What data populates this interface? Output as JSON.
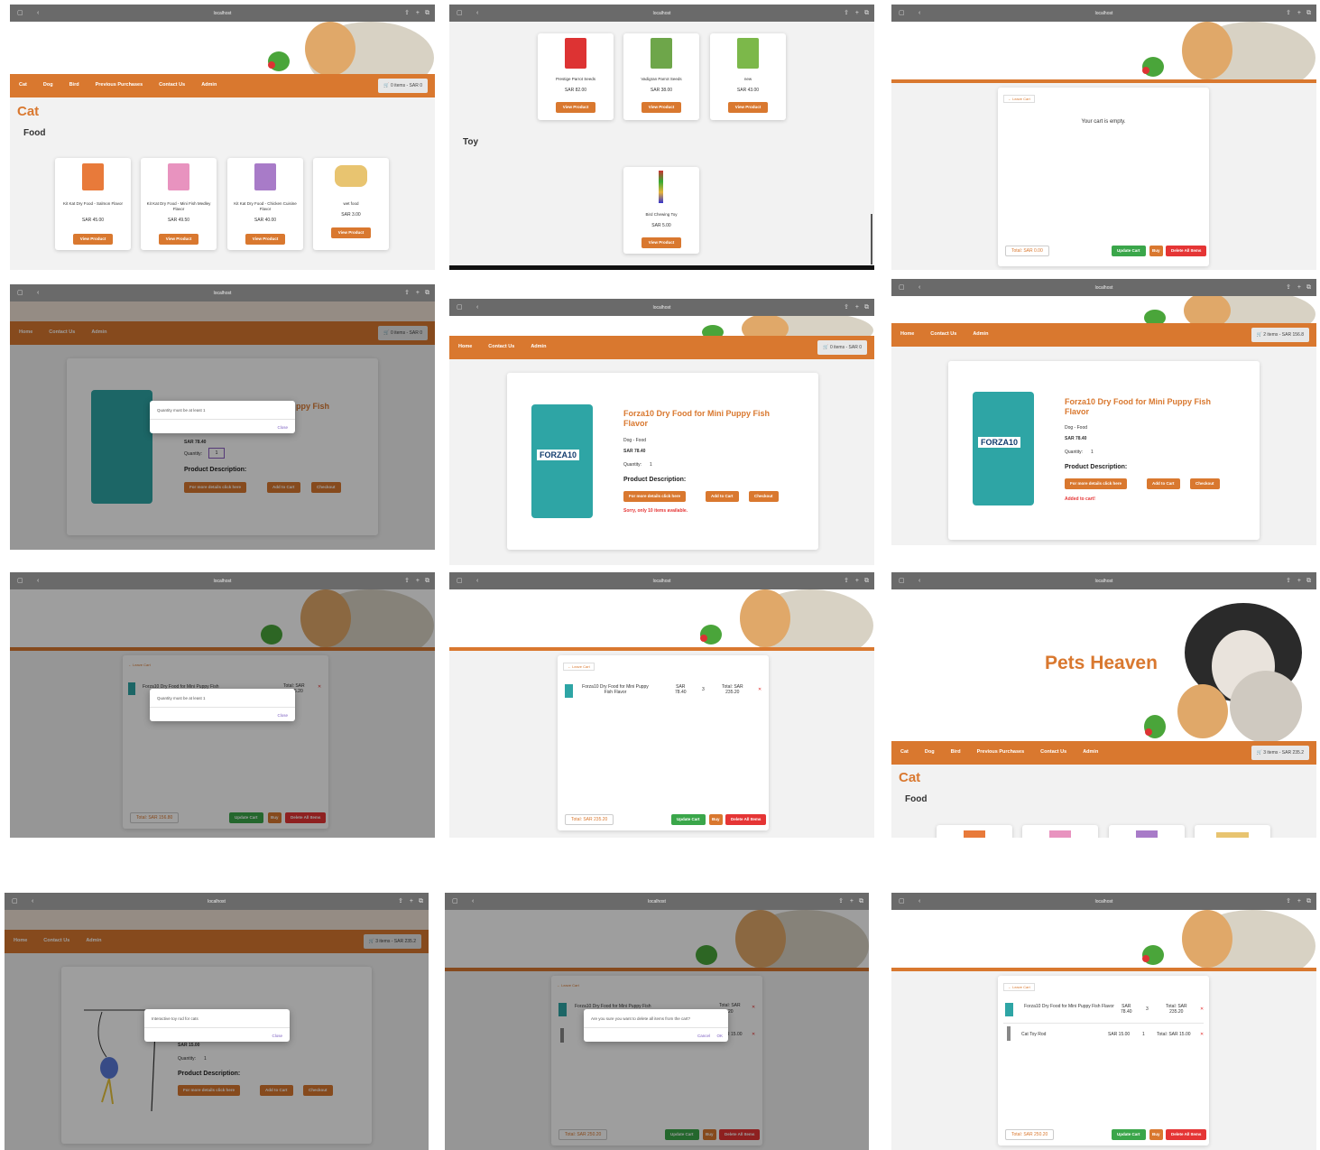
{
  "browser": {
    "url": "localhost"
  },
  "nav_main": [
    "Cat",
    "Dog",
    "Bird",
    "Previous Purchases",
    "Contact Us",
    "Admin"
  ],
  "nav_product": [
    "Home",
    "Contact Us",
    "Admin"
  ],
  "cart_labels": {
    "zero": "0 items - SAR 0",
    "two": "2 items - SAR 156.8",
    "three": "3 items - SAR 235.2"
  },
  "colors": {
    "brand_orange": "#d9782f",
    "success_green": "#3aa64a",
    "danger_red": "#e53535"
  },
  "icons": [
    "sidebar-icon",
    "back-icon",
    "forward-icon",
    "shield-icon",
    "reload-icon",
    "share-icon",
    "plus-icon",
    "tabs-icon",
    "cart-icon",
    "close-x-icon"
  ],
  "cat_page": {
    "heading": "Cat",
    "section": "Food",
    "products": [
      {
        "name": "Kit Kat Dry Food - Salmon Flavor",
        "price": "SAR 45.00",
        "button": "View Product"
      },
      {
        "name": "Kit Kat Dry Food - Mini Fish Medley Flavor",
        "price": "SAR 49.50",
        "button": "View Product"
      },
      {
        "name": "Kit Kat Dry Food - Chicken Cuisine Flavor",
        "price": "SAR 40.00",
        "button": "View Product"
      },
      {
        "name": "wet food",
        "price": "SAR 3.00",
        "button": "View Product"
      }
    ]
  },
  "bird_page": {
    "products": [
      {
        "name": "Prestige Parrot Seeds",
        "price": "SAR 82.00",
        "button": "View Product"
      },
      {
        "name": "Vadigran Parrot Seeds",
        "price": "SAR 38.00",
        "button": "View Product"
      },
      {
        "name": "new",
        "price": "SAR 43.00",
        "button": "View Product"
      }
    ],
    "toy_section": "Toy",
    "toy": {
      "name": "Bird Chewing Toy",
      "price": "SAR 5.00",
      "button": "View Product"
    }
  },
  "empty_cart": {
    "leave": "← Leave Cart",
    "message": "Your cart is empty.",
    "total": "Total: SAR 0.00"
  },
  "cart_actions": {
    "update": "Update Cart",
    "buy": "Buy",
    "delete_all": "Delete All Items"
  },
  "product": {
    "title": "Forza10 Dry Food for Mini Puppy Fish Flavor",
    "title_fragment": "ppy Fish",
    "category": "Dog - Food",
    "price": "SAR 78.40",
    "quantity_label": "Quantity:",
    "quantity_value": "1",
    "desc_heading": "Product Description:",
    "btn_details": "For more details click here",
    "btn_add": "Add to Cart",
    "btn_checkout": "Checkout",
    "msg_limit": "Sorry, only 10 items available.",
    "msg_added": "Added to cart!",
    "brand_logo": "FORZA10"
  },
  "dialogs": {
    "qty_min": "Quantity must be at least 1",
    "close": "Close",
    "toy_desc": "Interactive toy rod for cats",
    "delete_confirm": "Are you sure you want to delete all items from the cart?",
    "cancel": "Cancel",
    "ok": "OK"
  },
  "cart_rows": {
    "forza_name": "Forza10 Dry Food for Mini Puppy Fish Flavor",
    "forza_price": "SAR 78.40",
    "forza_price_line1": "SAR",
    "forza_price_line2": "78.40",
    "forza_total": "Total: SAR 235.20",
    "forza_total_line1": "Total: SAR",
    "forza_total_line2": "235.20",
    "forza_frag_name": "Forza10 Dry Food for Mini Puppy Fish",
    "forza_frag_total": "Total: SAR",
    "forza_frag_total2": "5.20",
    "forza_frag_total3": "20",
    "rod_name": "Cat Toy Rod",
    "rod_price": "SAR 15.00",
    "rod_total": "Total: SAR 15.00",
    "rod_frag": "R 15.00",
    "qty": "1",
    "qty3": "3"
  },
  "totals": {
    "t156": "Total: SAR 156.80",
    "t235": "Total: SAR 235.20",
    "t250": "Total: SAR 250.20"
  },
  "home": {
    "brand": "Pets Heaven",
    "heading": "Cat",
    "section": "Food"
  },
  "toy_page": {
    "price": "SAR 15.00"
  }
}
